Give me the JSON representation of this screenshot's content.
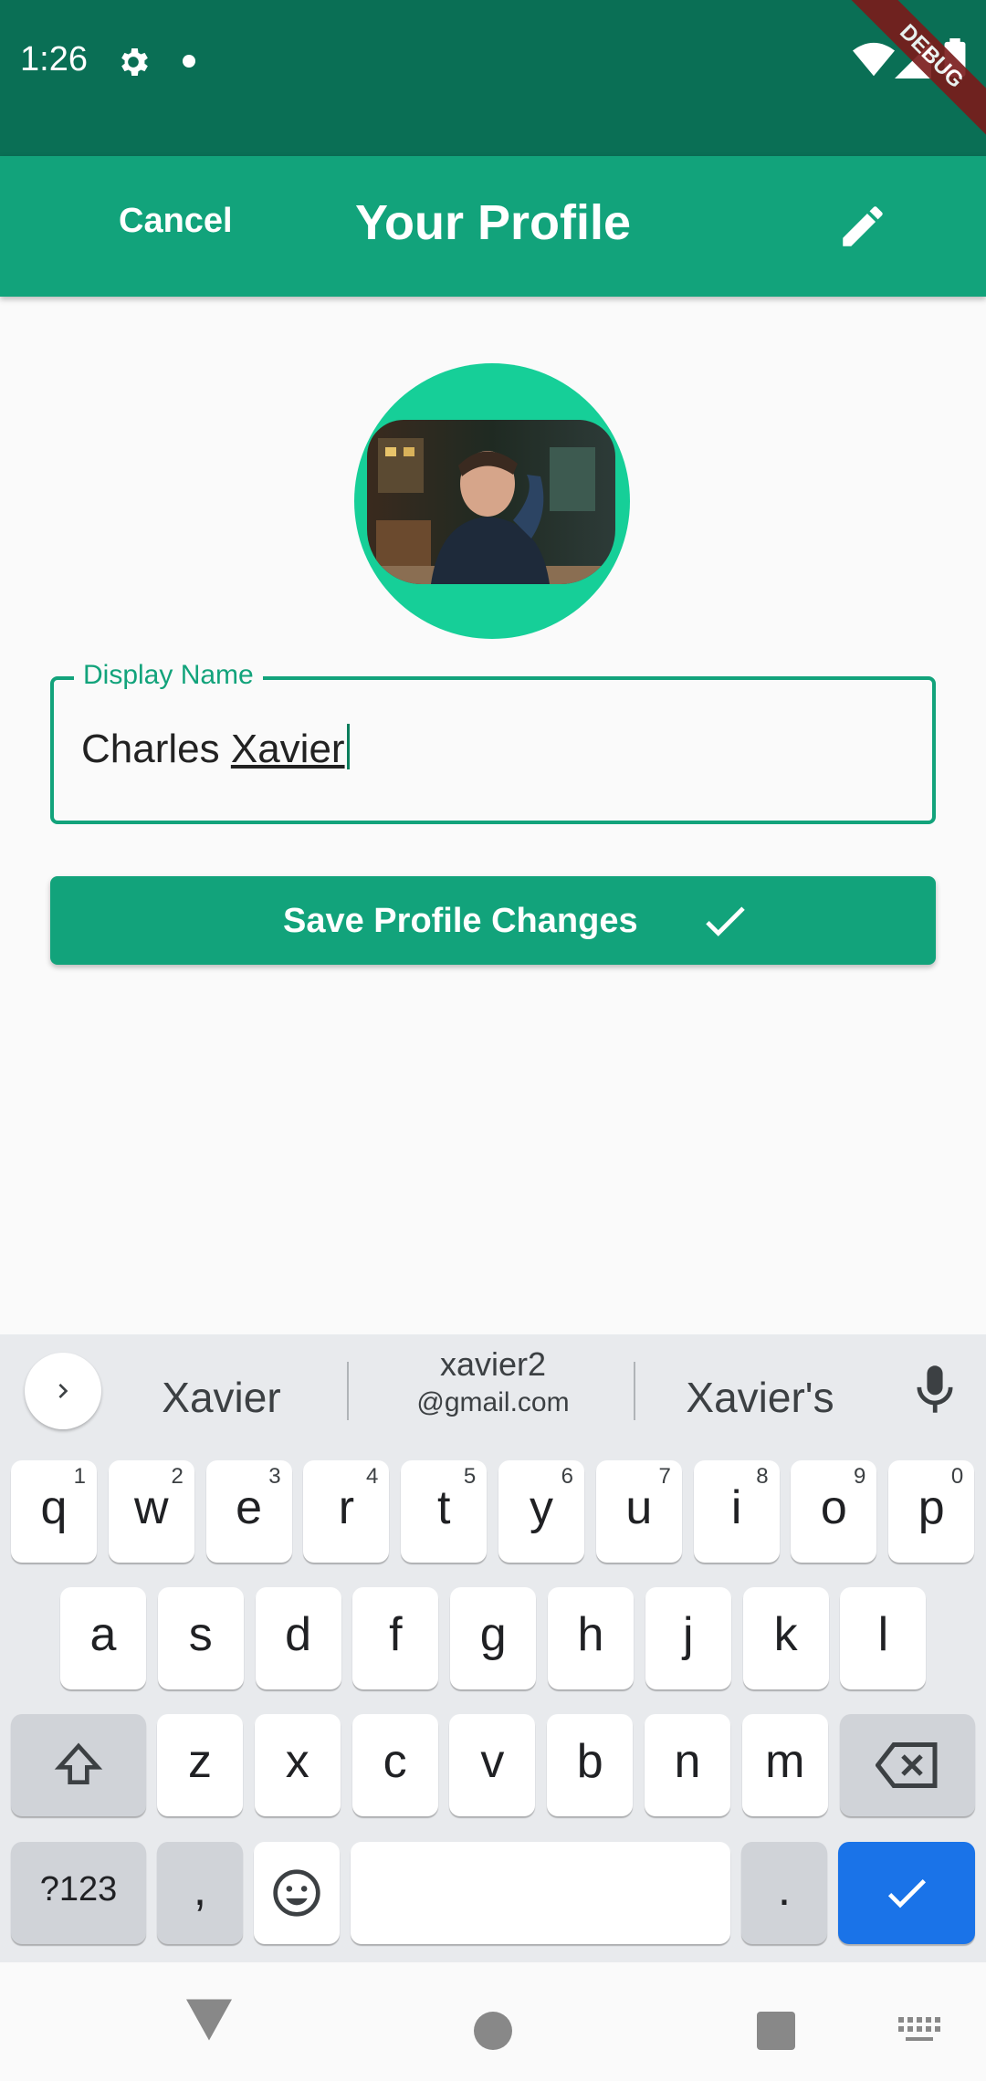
{
  "status_bar": {
    "time": "1:26",
    "debug_banner": "DEBUG",
    "icons": [
      "gear-icon",
      "dot-icon",
      "wifi-icon",
      "signal-icon",
      "battery-icon"
    ]
  },
  "app_bar": {
    "cancel_label": "Cancel",
    "title": "Your Profile",
    "edit_icon": "pencil-icon"
  },
  "profile": {
    "avatar_icon": "profile-photo"
  },
  "display_name_field": {
    "label": "Display Name",
    "value_first": "Charles ",
    "value_last": "Xavier"
  },
  "save_button": {
    "label": "Save Profile Changes",
    "icon": "check-icon"
  },
  "keyboard": {
    "suggestions": {
      "first": "Xavier",
      "second_line1": "xavier2",
      "second_line2": "@gmail.com",
      "third": "Xavier's"
    },
    "row1": [
      {
        "key": "q",
        "hint": "1"
      },
      {
        "key": "w",
        "hint": "2"
      },
      {
        "key": "e",
        "hint": "3"
      },
      {
        "key": "r",
        "hint": "4"
      },
      {
        "key": "t",
        "hint": "5"
      },
      {
        "key": "y",
        "hint": "6"
      },
      {
        "key": "u",
        "hint": "7"
      },
      {
        "key": "i",
        "hint": "8"
      },
      {
        "key": "o",
        "hint": "9"
      },
      {
        "key": "p",
        "hint": "0"
      }
    ],
    "row2": [
      "a",
      "s",
      "d",
      "f",
      "g",
      "h",
      "j",
      "k",
      "l"
    ],
    "row3": [
      "z",
      "x",
      "c",
      "v",
      "b",
      "n",
      "m"
    ],
    "symbols_label": "?123",
    "comma_label": ",",
    "period_label": ".",
    "colors": {
      "enter": "#1a73e8",
      "special": "#d0d3d8"
    }
  },
  "colors": {
    "status_bar": "#0a6f55",
    "primary": "#12a37b",
    "avatar_ring": "#16cf98"
  }
}
